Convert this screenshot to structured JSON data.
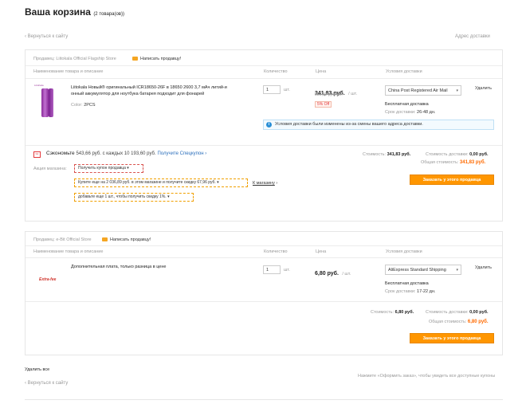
{
  "page": {
    "title": "Ваша корзина",
    "count": "(2 товара(ов))",
    "back_link": "‹ Вернуться к сайту",
    "address_link": "Адрес доставки",
    "delete_all": "Удалить все",
    "checkout_hint": "Нажмите «Оформить заказ», чтобы увидеть все доступные купоны"
  },
  "columns": {
    "product": "Наименование товара и описание",
    "quantity": "Количество",
    "price": "Цена",
    "shipping": "Условия доставки"
  },
  "seller1": {
    "label": "Продавец:",
    "name": "Liitokala Official Flagship Store",
    "message": "Написать продавцу!",
    "product_name_line1": "Liitokala Новый® оригинальный ICR18650-26F в 18650 2600 3,7 мАч литий-и",
    "product_name_line2": "онный аккумулятор для ноутбука батарея подходит для фонарей",
    "image_brand": "LiitoKala",
    "color_label": "Color:",
    "color_value": "2PCS",
    "quantity": "1",
    "unit": "шт.",
    "price": "341,83 руб.",
    "price_unit": "/ шт.",
    "old_price": "359,82 руб./шт.",
    "discount": "5% Off",
    "shipping_method": "China Post Registered Air Mail",
    "free_shipping": "Бесплатная доставка",
    "delivery_label": "Срок доставки:",
    "delivery_time": "26-48 дн.",
    "delete": "Удалить",
    "notice": "Условия доставки были изменены из-за смены вашего адреса доставки.",
    "coupon_text": "Сэкономьте",
    "coupon_amount": "543,66 руб. с каждых 10 193,60 руб.",
    "coupon_link": "Получите Спецкупон ›",
    "promo_label": "Акция магазина:",
    "promo1": "Получить купон продавца",
    "promo2": "Купите еще на 2 036,89 руб. в этом магазине и получите скидку 67,96 руб.",
    "promo2_link": "К магазину",
    "promo3": "добавьте еще 1 шт., чтобы получить скидку 1%.",
    "cost_label": "Стоимость:",
    "cost": "341,83 руб.",
    "ship_cost_label": "Стоимость доставки:",
    "ship_cost": "0,00 руб.",
    "total_label": "Общая стоимость:",
    "total": "341,83 руб.",
    "order_button": "Заказать у этого продавца"
  },
  "seller2": {
    "label": "Продавец:",
    "name": "e-Bit Official Store",
    "message": "Написать продавцу!",
    "product_name": "Дополнительная плата, только разница в цене",
    "image_brand": "Extra-fee",
    "quantity": "1",
    "unit": "шт.",
    "price": "6,80 руб.",
    "price_unit": "/ шт.",
    "shipping_method": "AliExpress Standard Shipping",
    "free_shipping": "Бесплатная доставка",
    "delivery_label": "Срок доставки:",
    "delivery_time": "17-22 дн.",
    "delete": "Удалить",
    "cost_label": "Стоимость:",
    "cost": "6,80 руб.",
    "ship_cost_label": "Стоимость доставки:",
    "ship_cost": "0,00 руб.",
    "total_label": "Общая стоимость:",
    "total": "6,80 руб.",
    "order_button": "Заказать у этого продавца"
  },
  "colors": {
    "accent": "#ff6a00",
    "button": "#ff9600",
    "link": "#2a6ebb"
  }
}
